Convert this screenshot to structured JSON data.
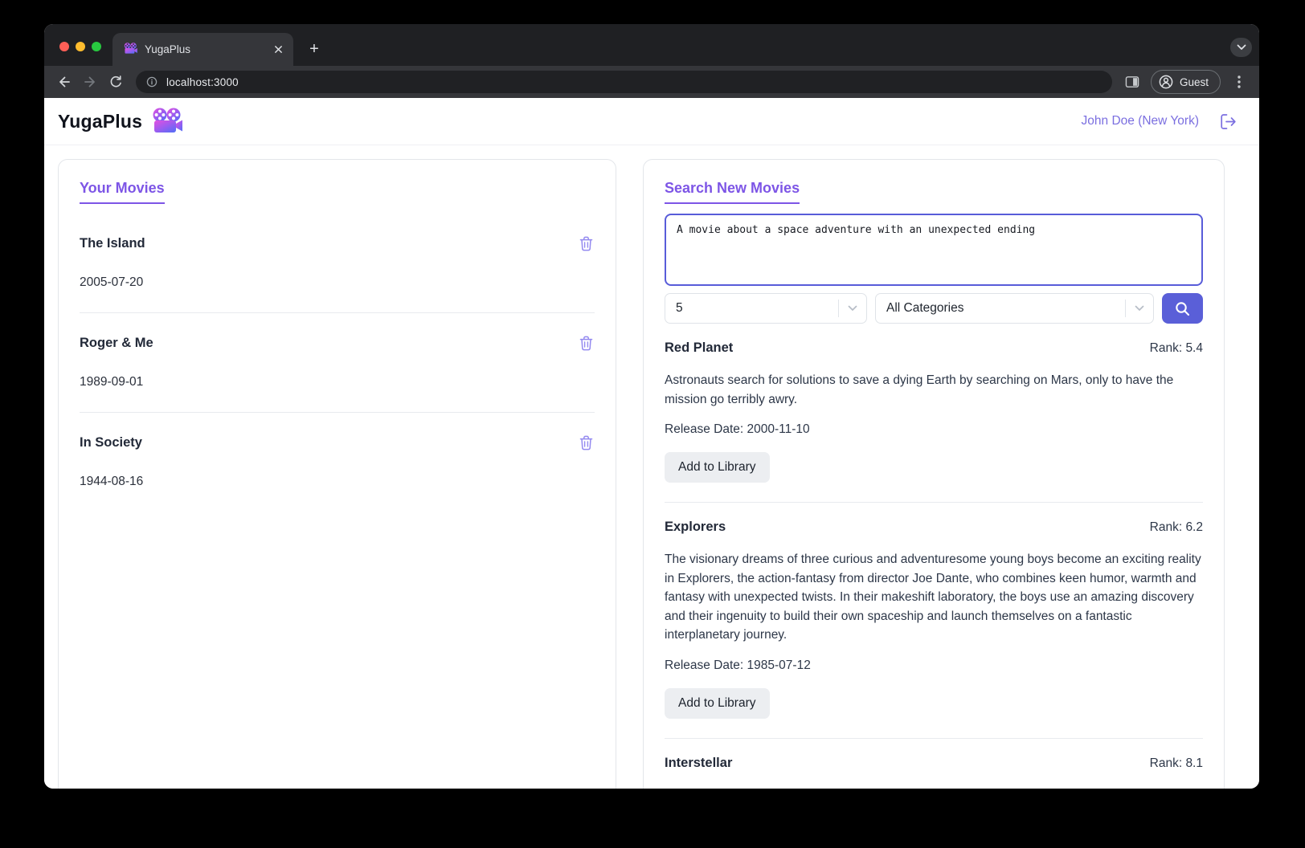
{
  "browser": {
    "tab": {
      "title": "YugaPlus"
    },
    "address": {
      "url": "localhost:3000"
    },
    "profile_label": "Guest"
  },
  "header": {
    "app_name": "YugaPlus",
    "user_label": "John Doe (New York)"
  },
  "library": {
    "title": "Your Movies",
    "movies": [
      {
        "title": "The Island",
        "date": "2005-07-20"
      },
      {
        "title": "Roger & Me",
        "date": "1989-09-01"
      },
      {
        "title": "In Society",
        "date": "1944-08-16"
      }
    ]
  },
  "search": {
    "title": "Search New Movies",
    "query": "A movie about a space adventure with an unexpected ending",
    "limit_value": "5",
    "category_value": "All Categories",
    "results": [
      {
        "title": "Red Planet",
        "rank": "Rank: 5.4",
        "description": "Astronauts search for solutions to save a dying Earth by searching on Mars, only to have the mission go terribly awry.",
        "release": "Release Date: 2000-11-10",
        "add_label": "Add to Library"
      },
      {
        "title": "Explorers",
        "rank": "Rank: 6.2",
        "description": "The visionary dreams of three curious and adventuresome young boys become an exciting reality in Explorers, the action-fantasy from director Joe Dante, who combines keen humor, warmth and fantasy with unexpected twists. In their makeshift laboratory, the boys use an amazing discovery and their ingenuity to build their own spaceship and launch themselves on a fantastic interplanetary journey.",
        "release": "Release Date: 1985-07-12",
        "add_label": "Add to Library"
      },
      {
        "title": "Interstellar",
        "rank": "Rank: 8.1"
      }
    ]
  },
  "icons": {
    "movie_camera": "gradient purple-pink film camera",
    "trash": "purple trash can outline",
    "logout": "door with right arrow",
    "search": "white magnifier",
    "chevron_down": "∨",
    "tab_close": "✕",
    "new_tab": "+",
    "info": "ⓘ",
    "guest_avatar": "person in circle",
    "kebab_menu": "⋮"
  },
  "colors": {
    "brand_purple": "#7d55e6",
    "accent_indigo": "#5a5fd8",
    "user_link_purple": "#7b6fe0",
    "trash_purple": "#948af0",
    "traffic_red": "#ff5f57",
    "traffic_yellow": "#febc2e",
    "traffic_green": "#28c840",
    "chrome_dark": "#1f2023",
    "chrome_toolbar": "#35363a"
  }
}
